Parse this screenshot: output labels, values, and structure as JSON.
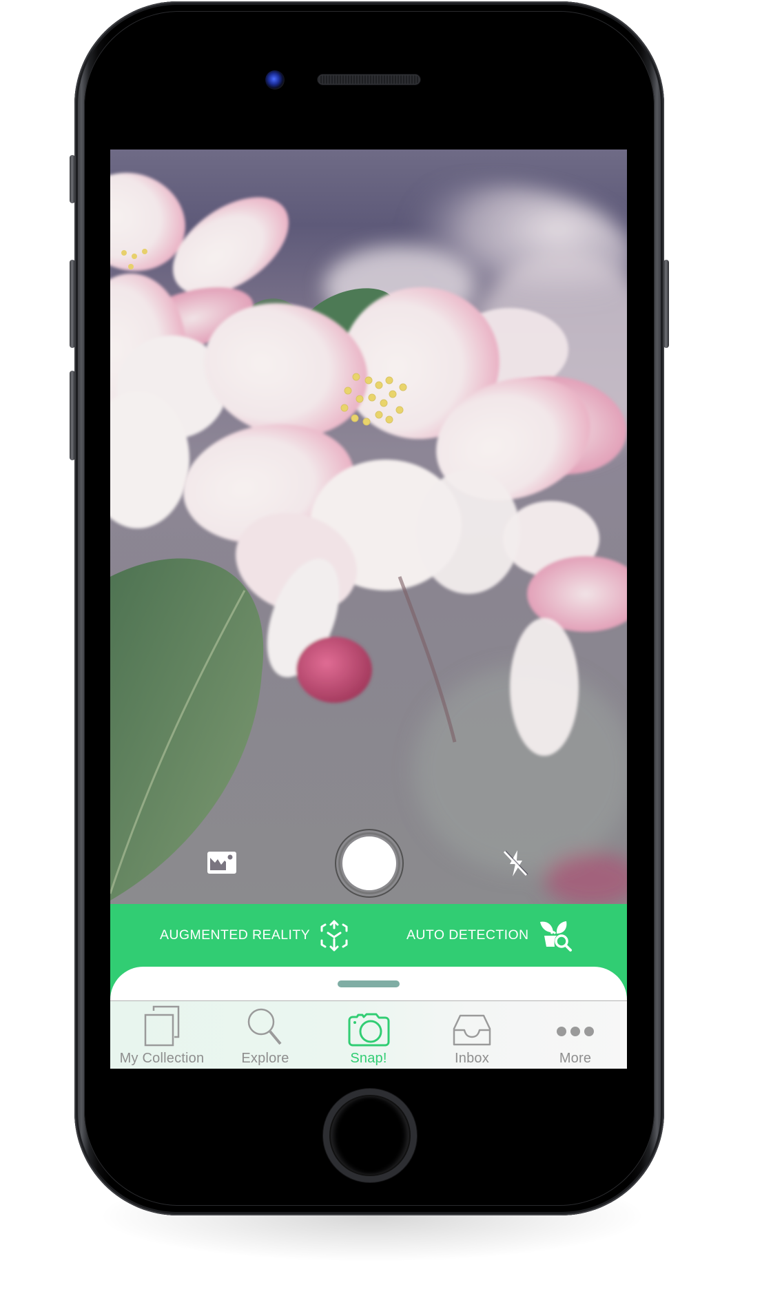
{
  "device": {
    "model_style": "phone-mockup",
    "body_color": "#1f2023"
  },
  "camera": {
    "controls": {
      "gallery": {
        "icon": "gallery-image-icon"
      },
      "shutter": {
        "icon": "shutter-button"
      },
      "flash": {
        "icon": "flash-off-icon",
        "state": "off"
      }
    }
  },
  "modes": {
    "color": "#31cd73",
    "items": [
      {
        "label": "AUGMENTED REALITY",
        "icon": "ar-cube-icon"
      },
      {
        "label": "AUTO DETECTION",
        "icon": "plant-search-icon"
      }
    ]
  },
  "sheet": {
    "handle_color": "#7fada4"
  },
  "tabbar": {
    "active_color": "#31cd73",
    "inactive_color": "#8e8e8e",
    "tabs": [
      {
        "label": "My Collection",
        "icon": "collection-icon",
        "active": false
      },
      {
        "label": "Explore",
        "icon": "search-icon",
        "active": false
      },
      {
        "label": "Snap!",
        "icon": "camera-icon",
        "active": true
      },
      {
        "label": "Inbox",
        "icon": "inbox-tray-icon",
        "active": false
      },
      {
        "label": "More",
        "icon": "more-dots-icon",
        "active": false
      }
    ]
  }
}
